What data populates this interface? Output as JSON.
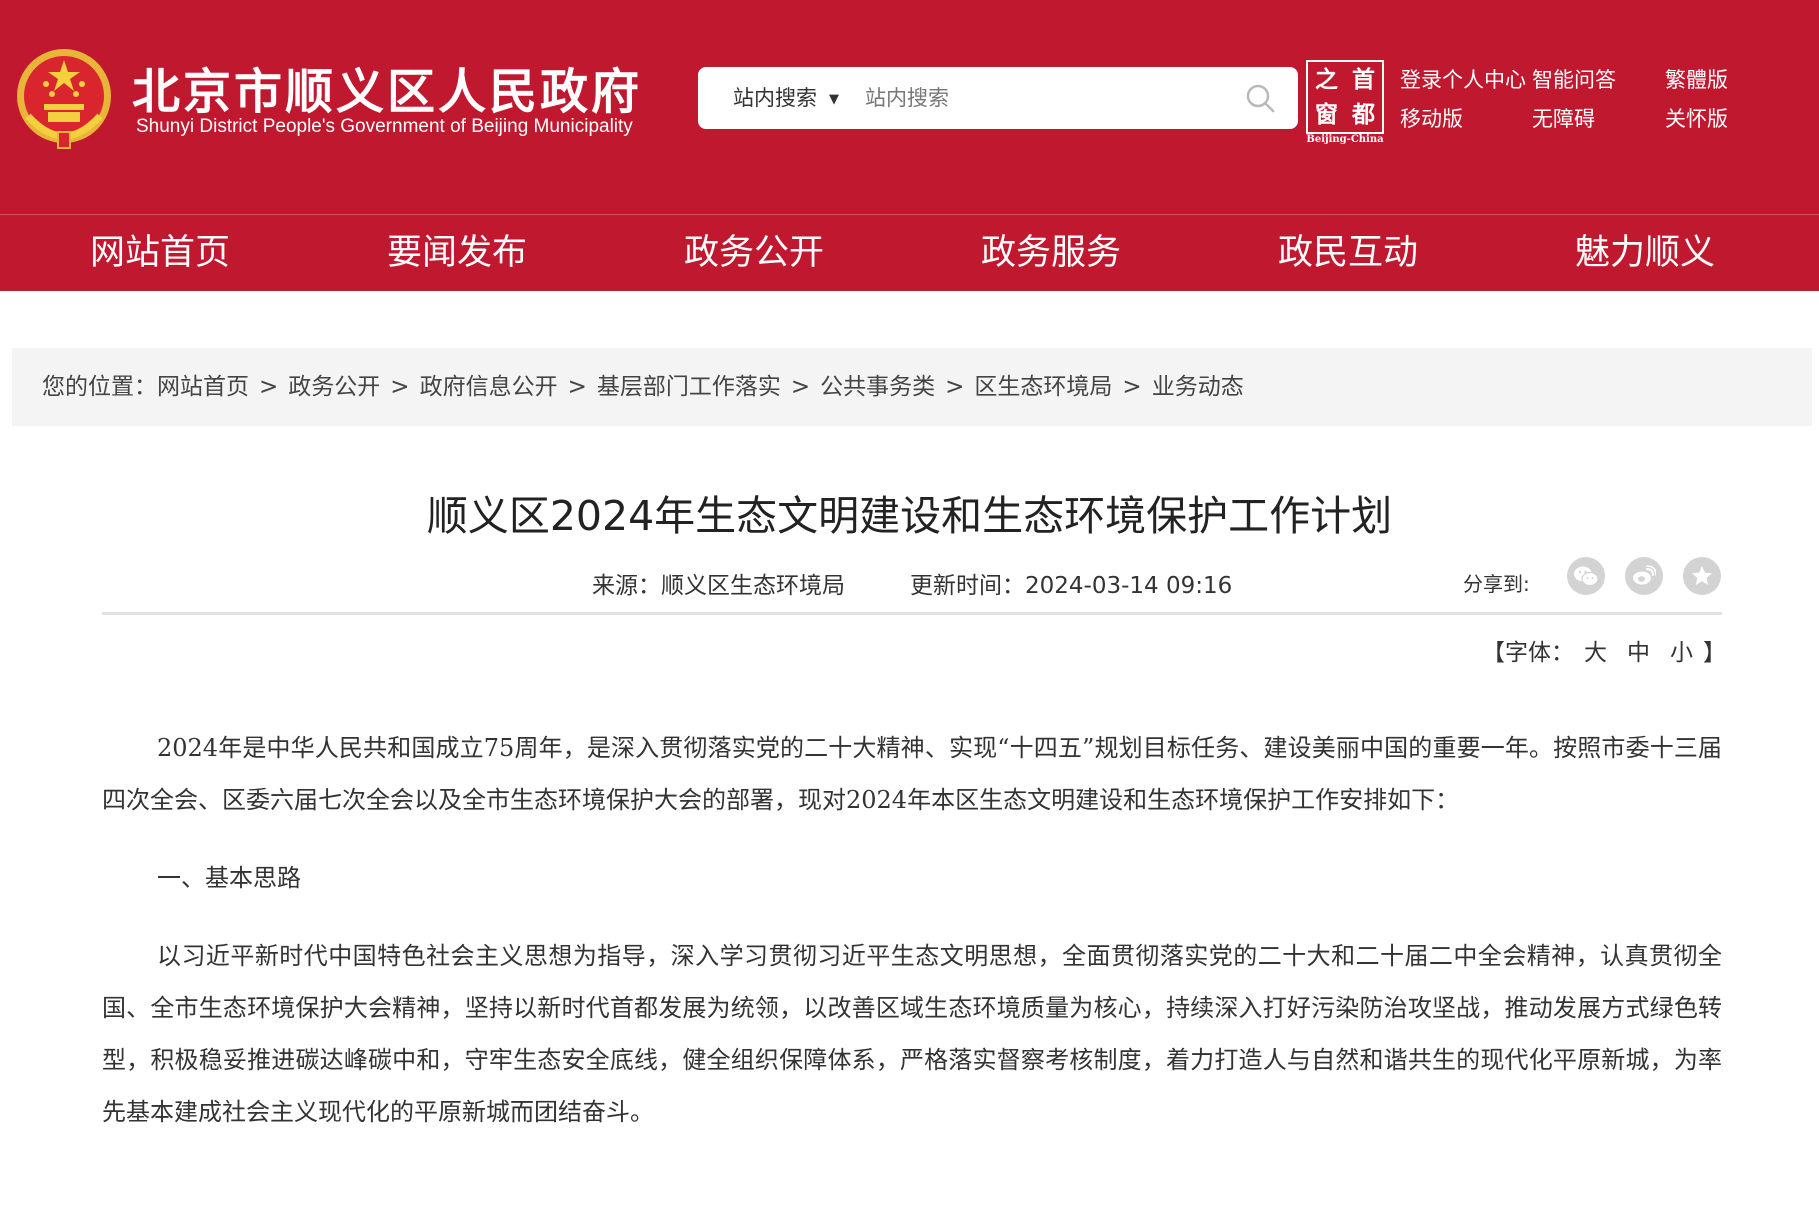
{
  "header": {
    "title": "北京市顺义区人民政府",
    "subtitle": "Shunyi District People's Government of Beijing Municipality",
    "search": {
      "scope_label": "站内搜索",
      "placeholder": "站内搜索"
    },
    "capital_logo": {
      "chars": [
        "之",
        "首",
        "窗",
        "都"
      ],
      "caption": "Beijing-China"
    },
    "links": {
      "login": "登录个人中心",
      "smart_qa": "智能问答",
      "traditional": "繁體版",
      "mobile": "移动版",
      "accessible": "无障碍",
      "care": "关怀版"
    },
    "colors": {
      "brand_red": "#c0182f"
    }
  },
  "nav": {
    "items": [
      "网站首页",
      "要闻发布",
      "政务公开",
      "政务服务",
      "政民互动",
      "魅力顺义"
    ]
  },
  "breadcrumb": {
    "prefix": "您的位置：",
    "separator": ">",
    "items": [
      "网站首页",
      "政务公开",
      "政府信息公开",
      "基层部门工作落实",
      "公共事务类",
      "区生态环境局",
      "业务动态"
    ]
  },
  "article": {
    "title": "顺义区2024年生态文明建设和生态环境保护工作计划",
    "source_label": "来源：",
    "source": "顺义区生态环境局",
    "updated_label": "更新时间：",
    "updated": "2024-03-14 09:16",
    "share_label": "分享到:",
    "share_icons": [
      "wechat-icon",
      "weibo-icon",
      "favorite-icon"
    ],
    "font_size": {
      "open": "【字体：",
      "large": "大",
      "medium": "中",
      "small": "小",
      "close": "】"
    },
    "body": {
      "intro": "2024年是中华人民共和国成立75周年，是深入贯彻落实党的二十大精神、实现“十四五”规划目标任务、建设美丽中国的重要一年。按照市委十三届四次全会、区委六届七次全会以及全市生态环境保护大会的部署，现对2024年本区生态文明建设和生态环境保护工作安排如下：",
      "section1_heading": "一、基本思路",
      "section1_text": "以习近平新时代中国特色社会主义思想为指导，深入学习贯彻习近平生态文明思想，全面贯彻落实党的二十大和二十届二中全会精神，认真贯彻全国、全市生态环境保护大会精神，坚持以新时代首都发展为统领，以改善区域生态环境质量为核心，持续深入打好污染防治攻坚战，推动发展方式绿色转型，积极稳妥推进碳达峰碳中和，守牢生态安全底线，健全组织保障体系，严格落实督察考核制度，着力打造人与自然和谐共生的现代化平原新城，为率先基本建成社会主义现代化的平原新城而团结奋斗。"
    }
  }
}
